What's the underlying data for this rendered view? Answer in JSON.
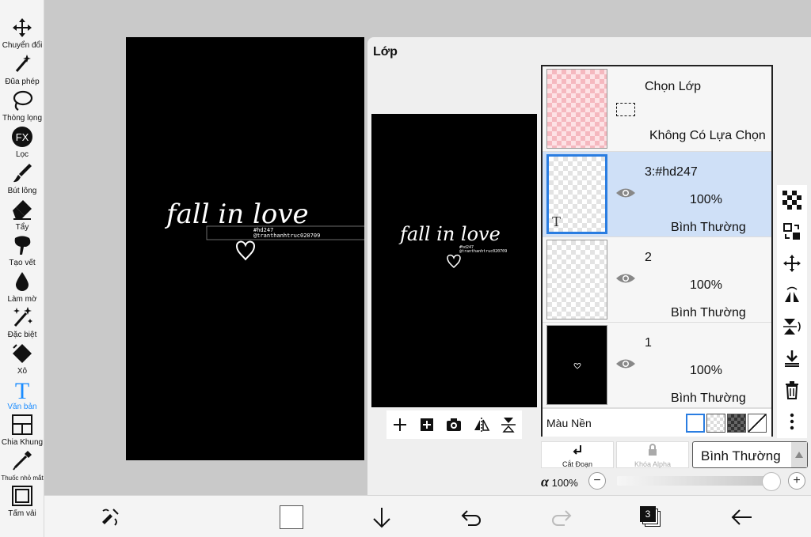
{
  "tools": [
    {
      "label": "Chuyển đổi",
      "icon": "move-icon"
    },
    {
      "label": "Đũa phép",
      "icon": "magic-wand-icon"
    },
    {
      "label": "Thòng lọng",
      "icon": "lasso-icon"
    },
    {
      "label": "Lọc",
      "icon": "fx-icon",
      "glyph": "FX"
    },
    {
      "label": "Bút lông",
      "icon": "brush-icon"
    },
    {
      "label": "Tẩy",
      "icon": "eraser-icon"
    },
    {
      "label": "Tạo vết",
      "icon": "smudge-icon"
    },
    {
      "label": "Làm mờ",
      "icon": "blur-icon"
    },
    {
      "label": "Đặc biệt",
      "icon": "special-icon"
    },
    {
      "label": "Xô",
      "icon": "bucket-icon"
    },
    {
      "label": "Văn bản",
      "icon": "text-icon",
      "glyph": "T",
      "active": true
    },
    {
      "label": "Chia Khung",
      "icon": "frame-divider-icon"
    },
    {
      "label": "Thuốc nhỏ mắt",
      "icon": "eyedropper-icon"
    },
    {
      "label": "Tấm vải",
      "icon": "canvas-icon"
    }
  ],
  "canvas": {
    "art_text": "fall in love",
    "tag1": "#hd247",
    "tag2": "@tranthanhtruc020709"
  },
  "panel": {
    "title": "Lớp",
    "selection_layer": {
      "title": "Chọn Lớp",
      "subtitle": "Không Có Lựa Chọn"
    },
    "layers": [
      {
        "name": "3:#hd247",
        "opacity": "100%",
        "mode": "Bình Thường",
        "thumb_glyph": "T",
        "selected": true
      },
      {
        "name": "2",
        "opacity": "100%",
        "mode": "Bình Thường"
      },
      {
        "name": "1",
        "opacity": "100%",
        "mode": "Bình Thường"
      }
    ],
    "bg_label": "Màu Nền",
    "clip_label": "Cắt Đoạn",
    "alpha_lock_label": "Khóa Alpha",
    "blend_mode": "Bình Thường",
    "alpha_symbol": "α",
    "alpha_value": "100%",
    "minus": "−",
    "plus": "+"
  },
  "bottom": {
    "layer_count": "3"
  },
  "colors": {
    "accent": "#1a8cff",
    "selected_row": "#cfe0f7",
    "selected_border": "#2a7de1"
  }
}
